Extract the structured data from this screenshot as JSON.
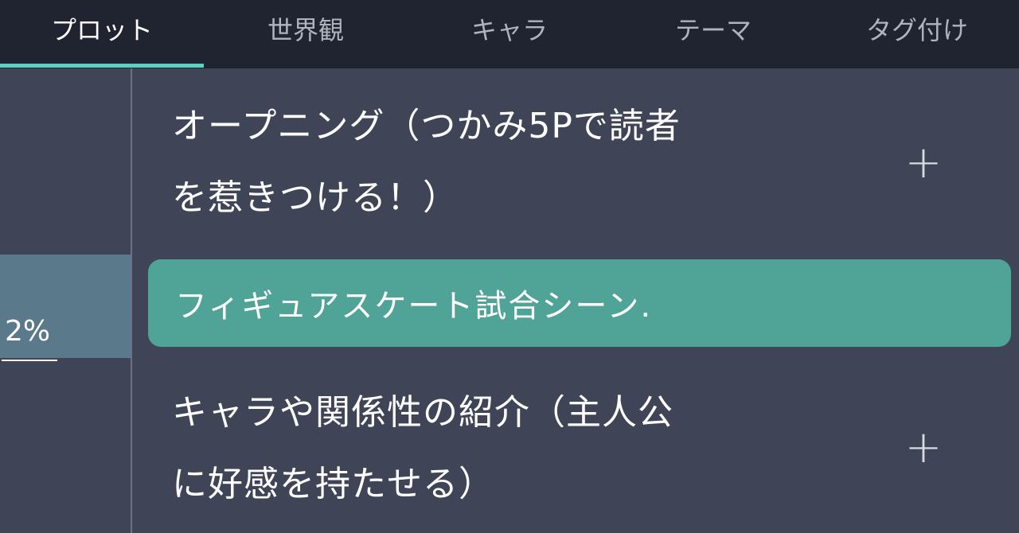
{
  "tabs": [
    {
      "label": "プロット",
      "active": true
    },
    {
      "label": "世界観",
      "active": false
    },
    {
      "label": "キャラ",
      "active": false
    },
    {
      "label": "テーマ",
      "active": false
    },
    {
      "label": "タグ付け",
      "active": false
    }
  ],
  "sidebar": {
    "progress_label": "2%"
  },
  "scenes": [
    {
      "line1": "オープニング（つかみ5Pで読者",
      "line2": "を惹きつける！）",
      "action_icon": "plus-icon",
      "action_label": "+"
    },
    {
      "text": "フィギュアスケート試合シーン.",
      "selected": true
    },
    {
      "line1": "キャラや関係性の紹介（主人公",
      "line2": "に好感を持たせる）",
      "action_icon": "plus-icon",
      "action_label": "+"
    }
  ],
  "colors": {
    "header_bg": "#1f2430",
    "body_bg": "#3f4557",
    "accent": "#5ecfc0",
    "selected_bg": "#4fa397",
    "sidebar_highlight": "#5a7a8c"
  }
}
